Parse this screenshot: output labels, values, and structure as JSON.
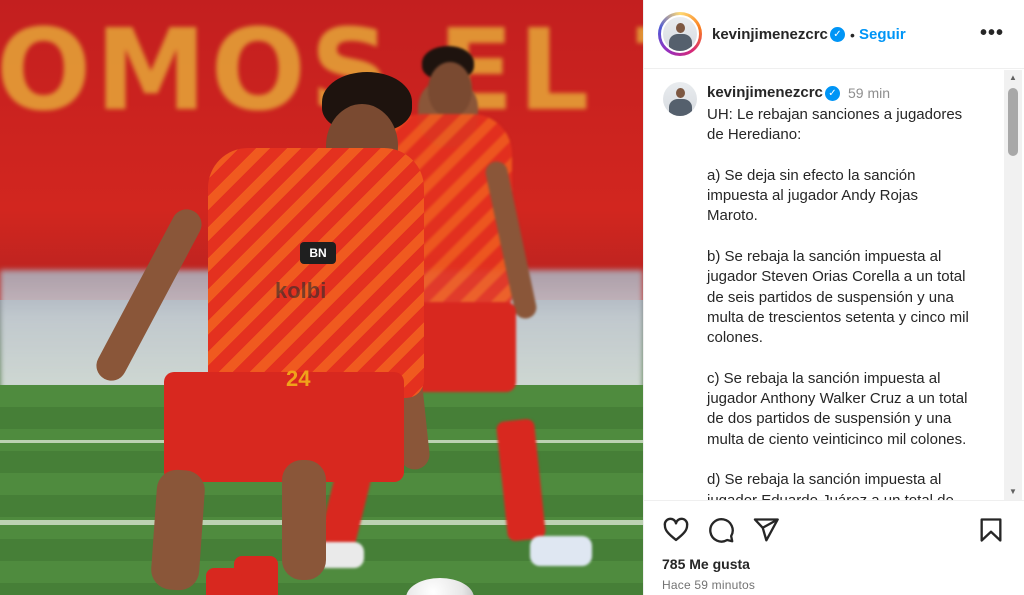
{
  "photo": {
    "banner_text": "OMOS EL T",
    "jersey_number": "24",
    "sponsor": "BN",
    "sponsor2": "kolbi"
  },
  "post": {
    "username": "kevinjimenezcrc",
    "follow_label": "Seguir",
    "separator": "•",
    "more_label": "•••",
    "caption_time": "59 min",
    "caption_lines": "UH: Le rebajan sanciones a jugadores\nde Herediano:\n\na) Se deja sin efecto la sanción\nimpuesta al jugador Andy Rojas\nMaroto.\n\nb) Se rebaja la sanción impuesta al\njugador Steven Orias Corella a un total\nde seis partidos de suspensión y una\nmulta de trescientos setenta y cinco mil\ncolones.\n\nc) Se rebaja la sanción impuesta al\njugador Anthony Walker Cruz a un total\nde dos partidos de suspensión y una\nmulta de ciento veinticinco mil colones.\n\nd) Se rebaja la sanción impuesta al\njugador Eduardo Juárez a un total de",
    "likes": "785 Me gusta",
    "time_ago": "Hace 59 minutos"
  },
  "icons": {
    "like": "heart-icon",
    "comment": "comment-icon",
    "share": "share-icon",
    "save": "bookmark-icon",
    "verified": "verified-badge-icon"
  },
  "colors": {
    "accent": "#0095f6",
    "text": "#262626",
    "muted": "#8e8e8e"
  }
}
